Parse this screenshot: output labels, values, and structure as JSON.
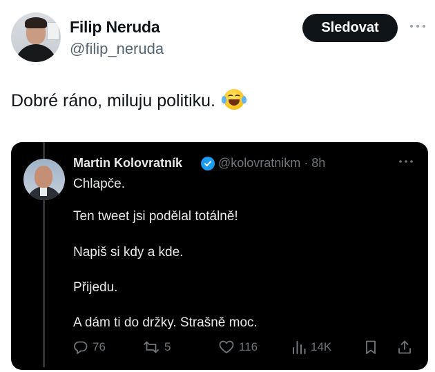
{
  "author": {
    "display_name": "Filip Neruda",
    "handle": "@filip_neruda",
    "follow_label": "Sledovat",
    "more_icon": "ellipsis-icon"
  },
  "tweet": {
    "text": "Dobré ráno, miluju politiku.",
    "emoji": "face-with-tears-of-joy"
  },
  "quoted": {
    "display_name": "Martin Kolovratník",
    "verified_icon": "verified-badge-icon",
    "handle_time": "@kolovratnikm · 8h",
    "lines": [
      "Chlapče.",
      "Ten tweet jsi podělal totálně!",
      "Napiš si kdy a kde.",
      "Přijedu.",
      "A dám ti do držky. Strašně moc."
    ],
    "actions": {
      "replies": "76",
      "reposts": "5",
      "likes": "116",
      "views": "14K"
    }
  },
  "colors": {
    "follow_bg": "#0f1419",
    "card_bg": "#000000",
    "verified": "#1d9bf0",
    "muted": "#71767b"
  }
}
